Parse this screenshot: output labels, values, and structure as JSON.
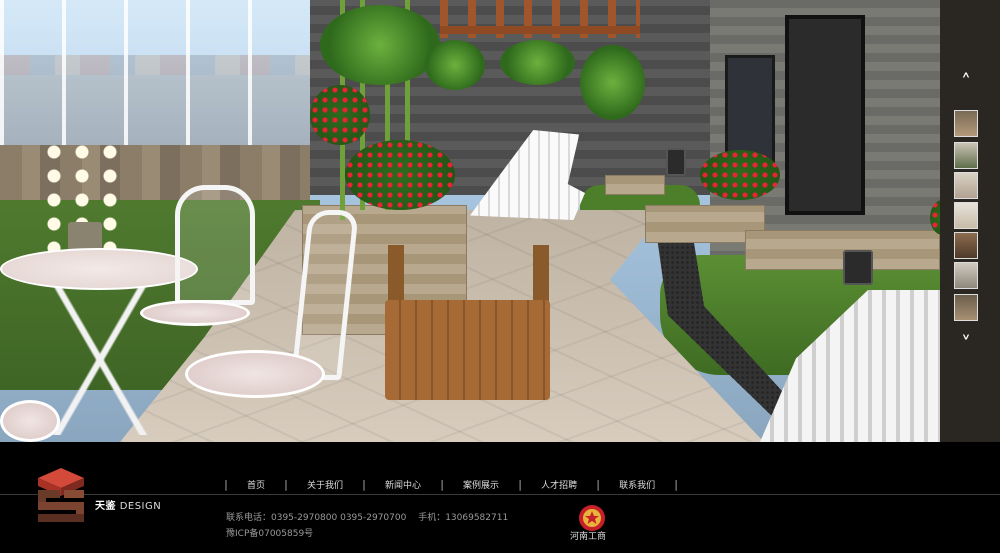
{
  "hero": {
    "description_icon": "garden-photo"
  },
  "thumbnails": {
    "up_arrow": "˄",
    "down_arrow": "˅",
    "count": 7
  },
  "brand": {
    "name_cn": "天鉴",
    "name_en": "DESIGN"
  },
  "nav": {
    "items": [
      "首页",
      "关于我们",
      "新闻中心",
      "案例展示",
      "人才招聘",
      "联系我们"
    ]
  },
  "contact": {
    "phone_line": "联系电话：0395-2970800 0395-2970700 　手机：13069582711",
    "icp": "豫ICP备07005859号"
  },
  "badge": {
    "label": "河南工商"
  },
  "colors": {
    "footer_bg": "#000000",
    "logo_red": "#c0392b",
    "logo_brown": "#6b3b2a",
    "badge_red": "#c8202a"
  }
}
